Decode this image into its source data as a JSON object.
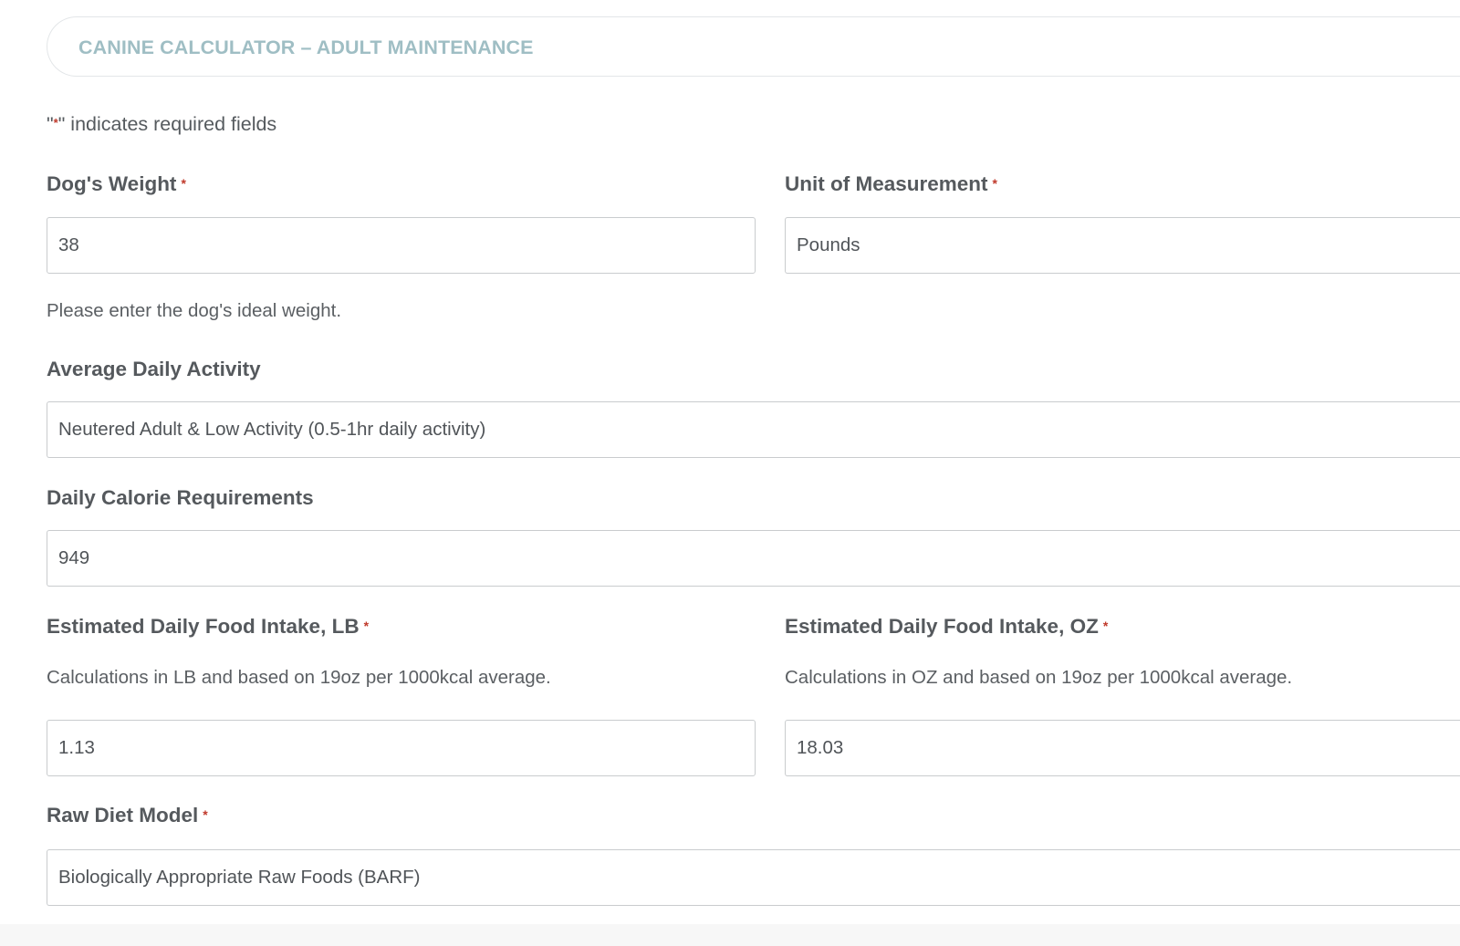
{
  "header": {
    "title": "CANINE CALCULATOR – ADULT MAINTENANCE"
  },
  "required_note": {
    "quote_open": "\"",
    "star": "*",
    "quote_close_text": "\" indicates required fields"
  },
  "fields": {
    "dog_weight": {
      "label": "Dog's Weight",
      "value": "38",
      "required_mark": "*",
      "description": "Please enter the dog's ideal weight."
    },
    "unit": {
      "label": "Unit of Measurement",
      "value": "Pounds",
      "required_mark": "*"
    },
    "activity": {
      "label": "Average Daily Activity",
      "value": "Neutered Adult & Low Activity (0.5-1hr daily activity)"
    },
    "calories": {
      "label": "Daily Calorie Requirements",
      "value": "949"
    },
    "intake_lb": {
      "label": "Estimated Daily Food Intake, LB",
      "required_mark": "*",
      "description": "Calculations in LB and based on 19oz per 1000kcal average.",
      "value": "1.13"
    },
    "intake_oz": {
      "label": "Estimated Daily Food Intake, OZ",
      "required_mark": "*",
      "description": "Calculations in OZ and based on 19oz per 1000kcal average.",
      "value": "18.03"
    },
    "raw_diet": {
      "label": "Raw Diet Model",
      "required_mark": "*",
      "value": "Biologically Appropriate Raw Foods (BARF)"
    }
  }
}
